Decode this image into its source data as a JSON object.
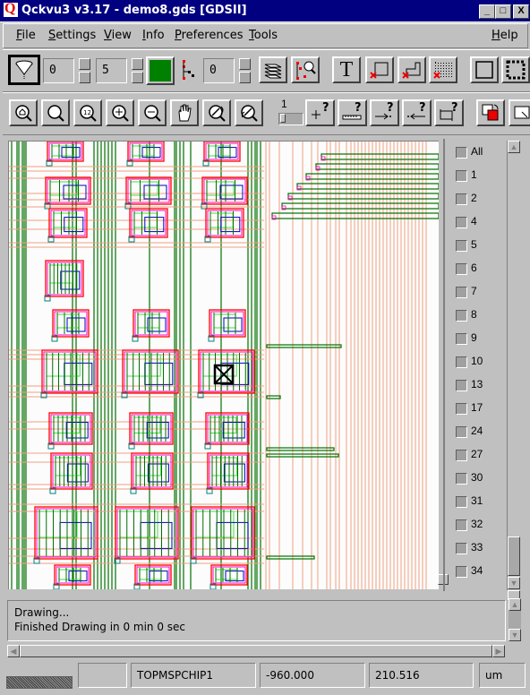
{
  "window": {
    "title": "Qckvu3 v3.17 - demo8.gds [GDSII]",
    "app_icon_letter": "Q",
    "minimize_label": "_",
    "maximize_label": "□",
    "close_label": "X"
  },
  "menu": {
    "items": [
      {
        "label": "File",
        "mnemonic": "F"
      },
      {
        "label": "Settings",
        "mnemonic": "S"
      },
      {
        "label": "View",
        "mnemonic": "V"
      },
      {
        "label": "Info",
        "mnemonic": "I"
      },
      {
        "label": "Preferences",
        "mnemonic": "P"
      },
      {
        "label": "Tools",
        "mnemonic": "T"
      },
      {
        "label": "Help",
        "mnemonic": "H"
      }
    ]
  },
  "toolbar1": {
    "filter_icon": "filter-funnel-icon",
    "level_min_value": "0",
    "level_max_value": "5",
    "fill_color": "#008000",
    "hierarchy_icon": "hierarchy-tree-icon",
    "hierarchy_value": "0",
    "tools": [
      {
        "name": "layers-stack-icon"
      },
      {
        "name": "hierarchy-search-icon"
      },
      {
        "name": "text-tool-icon",
        "glyph": "T"
      },
      {
        "name": "box-measure-icon"
      },
      {
        "name": "path-measure-icon"
      },
      {
        "name": "grid-measure-icon"
      },
      {
        "name": "outline-box-icon"
      },
      {
        "name": "dashed-box-icon"
      }
    ]
  },
  "toolbar2": {
    "zoom_tools": [
      {
        "name": "zoom-home-icon"
      },
      {
        "name": "zoom-window-icon"
      },
      {
        "name": "zoom-fit-icon"
      },
      {
        "name": "zoom-in-icon"
      },
      {
        "name": "zoom-out-icon"
      },
      {
        "name": "pan-hand-icon"
      },
      {
        "name": "zoom-previous-icon"
      },
      {
        "name": "zoom-next-icon"
      }
    ],
    "slider_label": "1",
    "query_tools": [
      {
        "name": "query-point-icon"
      },
      {
        "name": "query-ruler-icon"
      },
      {
        "name": "query-right-arrow-icon"
      },
      {
        "name": "query-left-arrow-icon"
      },
      {
        "name": "query-box-icon"
      }
    ],
    "extra_tools": [
      {
        "name": "color-swap-icon"
      },
      {
        "name": "edit-pencil-icon"
      }
    ]
  },
  "layers": {
    "items": [
      "All",
      "1",
      "2",
      "4",
      "5",
      "6",
      "7",
      "8",
      "9",
      "10",
      "13",
      "17",
      "24",
      "27",
      "30",
      "31",
      "32",
      "33",
      "34"
    ]
  },
  "layout_colors": {
    "background": "#fcfcfc",
    "metal_green": "#007000",
    "orange_lines": "#f0a080",
    "blue": "#0000c0",
    "magenta": "#ff00c0",
    "red": "#ff0000",
    "light_green": "#40e040",
    "teal": "#008080"
  },
  "messages": {
    "lines": [
      "Drawing...",
      "Finished Drawing in 0 min 0 sec"
    ]
  },
  "status": {
    "empty_field": "",
    "cell_name": "TOPMSPCHIP1",
    "x_coord": "-960.000",
    "y_coord": "210.516",
    "units": "um"
  }
}
